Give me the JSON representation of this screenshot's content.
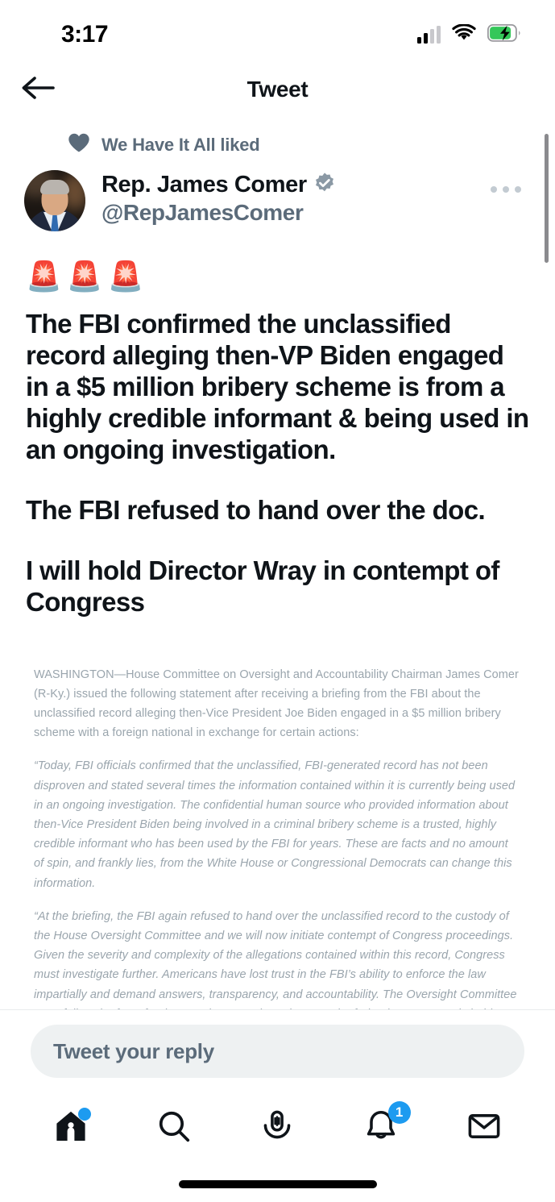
{
  "status_bar": {
    "time": "3:17",
    "signal_icon": "cellular-signal-icon",
    "wifi_icon": "wifi-icon",
    "battery_icon": "battery-charging-icon",
    "battery_color": "#34c759"
  },
  "top_nav": {
    "back_icon": "back-arrow-icon",
    "title": "Tweet"
  },
  "social_context": {
    "heart_icon": "heart-filled-icon",
    "label": "We Have It All liked",
    "color": "#5b6b7a"
  },
  "tweet": {
    "author": {
      "display_name": "Rep. James Comer",
      "handle": "@RepJamesComer",
      "verified": true,
      "verified_badge_color": "#8b99a5",
      "avatar_alt": "Rep. James Comer headshot"
    },
    "more_options_icon": "more-horizontal-icon",
    "emoji_line": "🚨🚨🚨",
    "paragraphs": [
      "The FBI confirmed the unclassified record alleging then-VP Biden engaged in a $5 million bribery scheme is from a highly credible informant & being used in an ongoing investigation.",
      "The FBI refused to hand over the doc.",
      "I will hold Director Wray in contempt of Congress"
    ],
    "press_release": [
      {
        "style": "normal",
        "text": "WASHINGTON—House Committee on Oversight and Accountability Chairman James Comer (R-Ky.) issued the following statement after receiving a briefing from the FBI about the unclassified record alleging then-Vice President Joe Biden engaged in a $5 million bribery scheme with a foreign national in exchange for certain actions:"
      },
      {
        "style": "italic",
        "text": "“Today, FBI officials confirmed that the unclassified, FBI-generated record has not been disproven and stated several times the information contained within it is currently being used in an ongoing investigation. The confidential human source who provided information about then-Vice President Biden being involved in a criminal bribery scheme is a trusted, highly credible informant who has been used by the FBI for years. These are facts and no amount of spin, and frankly lies, from the White House or Congressional Democrats can change this information."
      },
      {
        "style": "italic",
        "text": "“At the briefing, the FBI again refused to hand over the unclassified record to the custody of the House Oversight Committee and we will now initiate contempt of Congress proceedings. Given the severity and complexity of the allegations contained within this record, Congress must investigate further. Americans have lost trust in the FBI’s ability to enforce the law impartially and demand answers, transparency, and accountability. The Oversight Committee must follow the facts for the American people and ensure the federal government is held accountable.”"
      }
    ]
  },
  "reply": {
    "placeholder": "Tweet your reply"
  },
  "bottom_nav": {
    "accent_color": "#1d9bf0",
    "items": [
      {
        "name": "home",
        "icon": "home-icon",
        "has_dot": true,
        "badge": ""
      },
      {
        "name": "search",
        "icon": "search-icon",
        "has_dot": false,
        "badge": ""
      },
      {
        "name": "spaces",
        "icon": "spaces-microphone-icon",
        "has_dot": false,
        "badge": ""
      },
      {
        "name": "notifications",
        "icon": "bell-icon",
        "has_dot": false,
        "badge": "1"
      },
      {
        "name": "messages",
        "icon": "envelope-icon",
        "has_dot": false,
        "badge": ""
      }
    ]
  }
}
